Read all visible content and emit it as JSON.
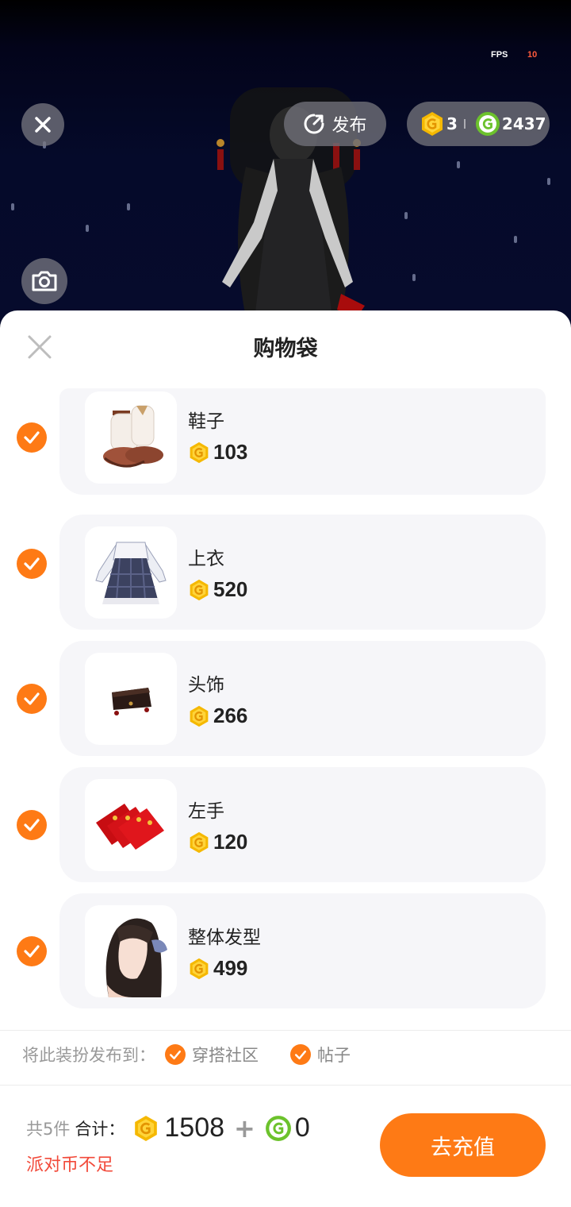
{
  "hud": {
    "fps_label": "FPS",
    "fps_value": "10"
  },
  "toolbar": {
    "publish_label": "发布"
  },
  "wallet": {
    "party_coins": "3",
    "g_coins": "2437"
  },
  "sheet": {
    "title": "购物袋"
  },
  "items": [
    {
      "name": "鞋子",
      "price": "103",
      "checked": true,
      "icon": "shoes-thumbnail"
    },
    {
      "name": "上衣",
      "price": "520",
      "checked": true,
      "icon": "dress-thumbnail"
    },
    {
      "name": "头饰",
      "price": "266",
      "checked": true,
      "icon": "headwear-thumbnail"
    },
    {
      "name": "左手",
      "price": "120",
      "checked": true,
      "icon": "red-envelopes-thumbnail"
    },
    {
      "name": "整体发型",
      "price": "499",
      "checked": true,
      "icon": "hairstyle-thumbnail"
    }
  ],
  "publish_to": {
    "label": "将此装扮发布到：",
    "options": [
      {
        "label": "穿搭社区",
        "checked": true
      },
      {
        "label": "帖子",
        "checked": true
      }
    ]
  },
  "summary": {
    "count": "共5件",
    "total_label": "合计：",
    "party_coin_total": "1508",
    "plus": "+",
    "g_coin_total": "0",
    "warning": "派对币不足"
  },
  "actions": {
    "recharge_label": "去充值"
  },
  "colors": {
    "accent": "#fe7a15",
    "warning": "#f24a3a",
    "party_coin": "#f5b800",
    "g_coin": "#6cc22c"
  }
}
